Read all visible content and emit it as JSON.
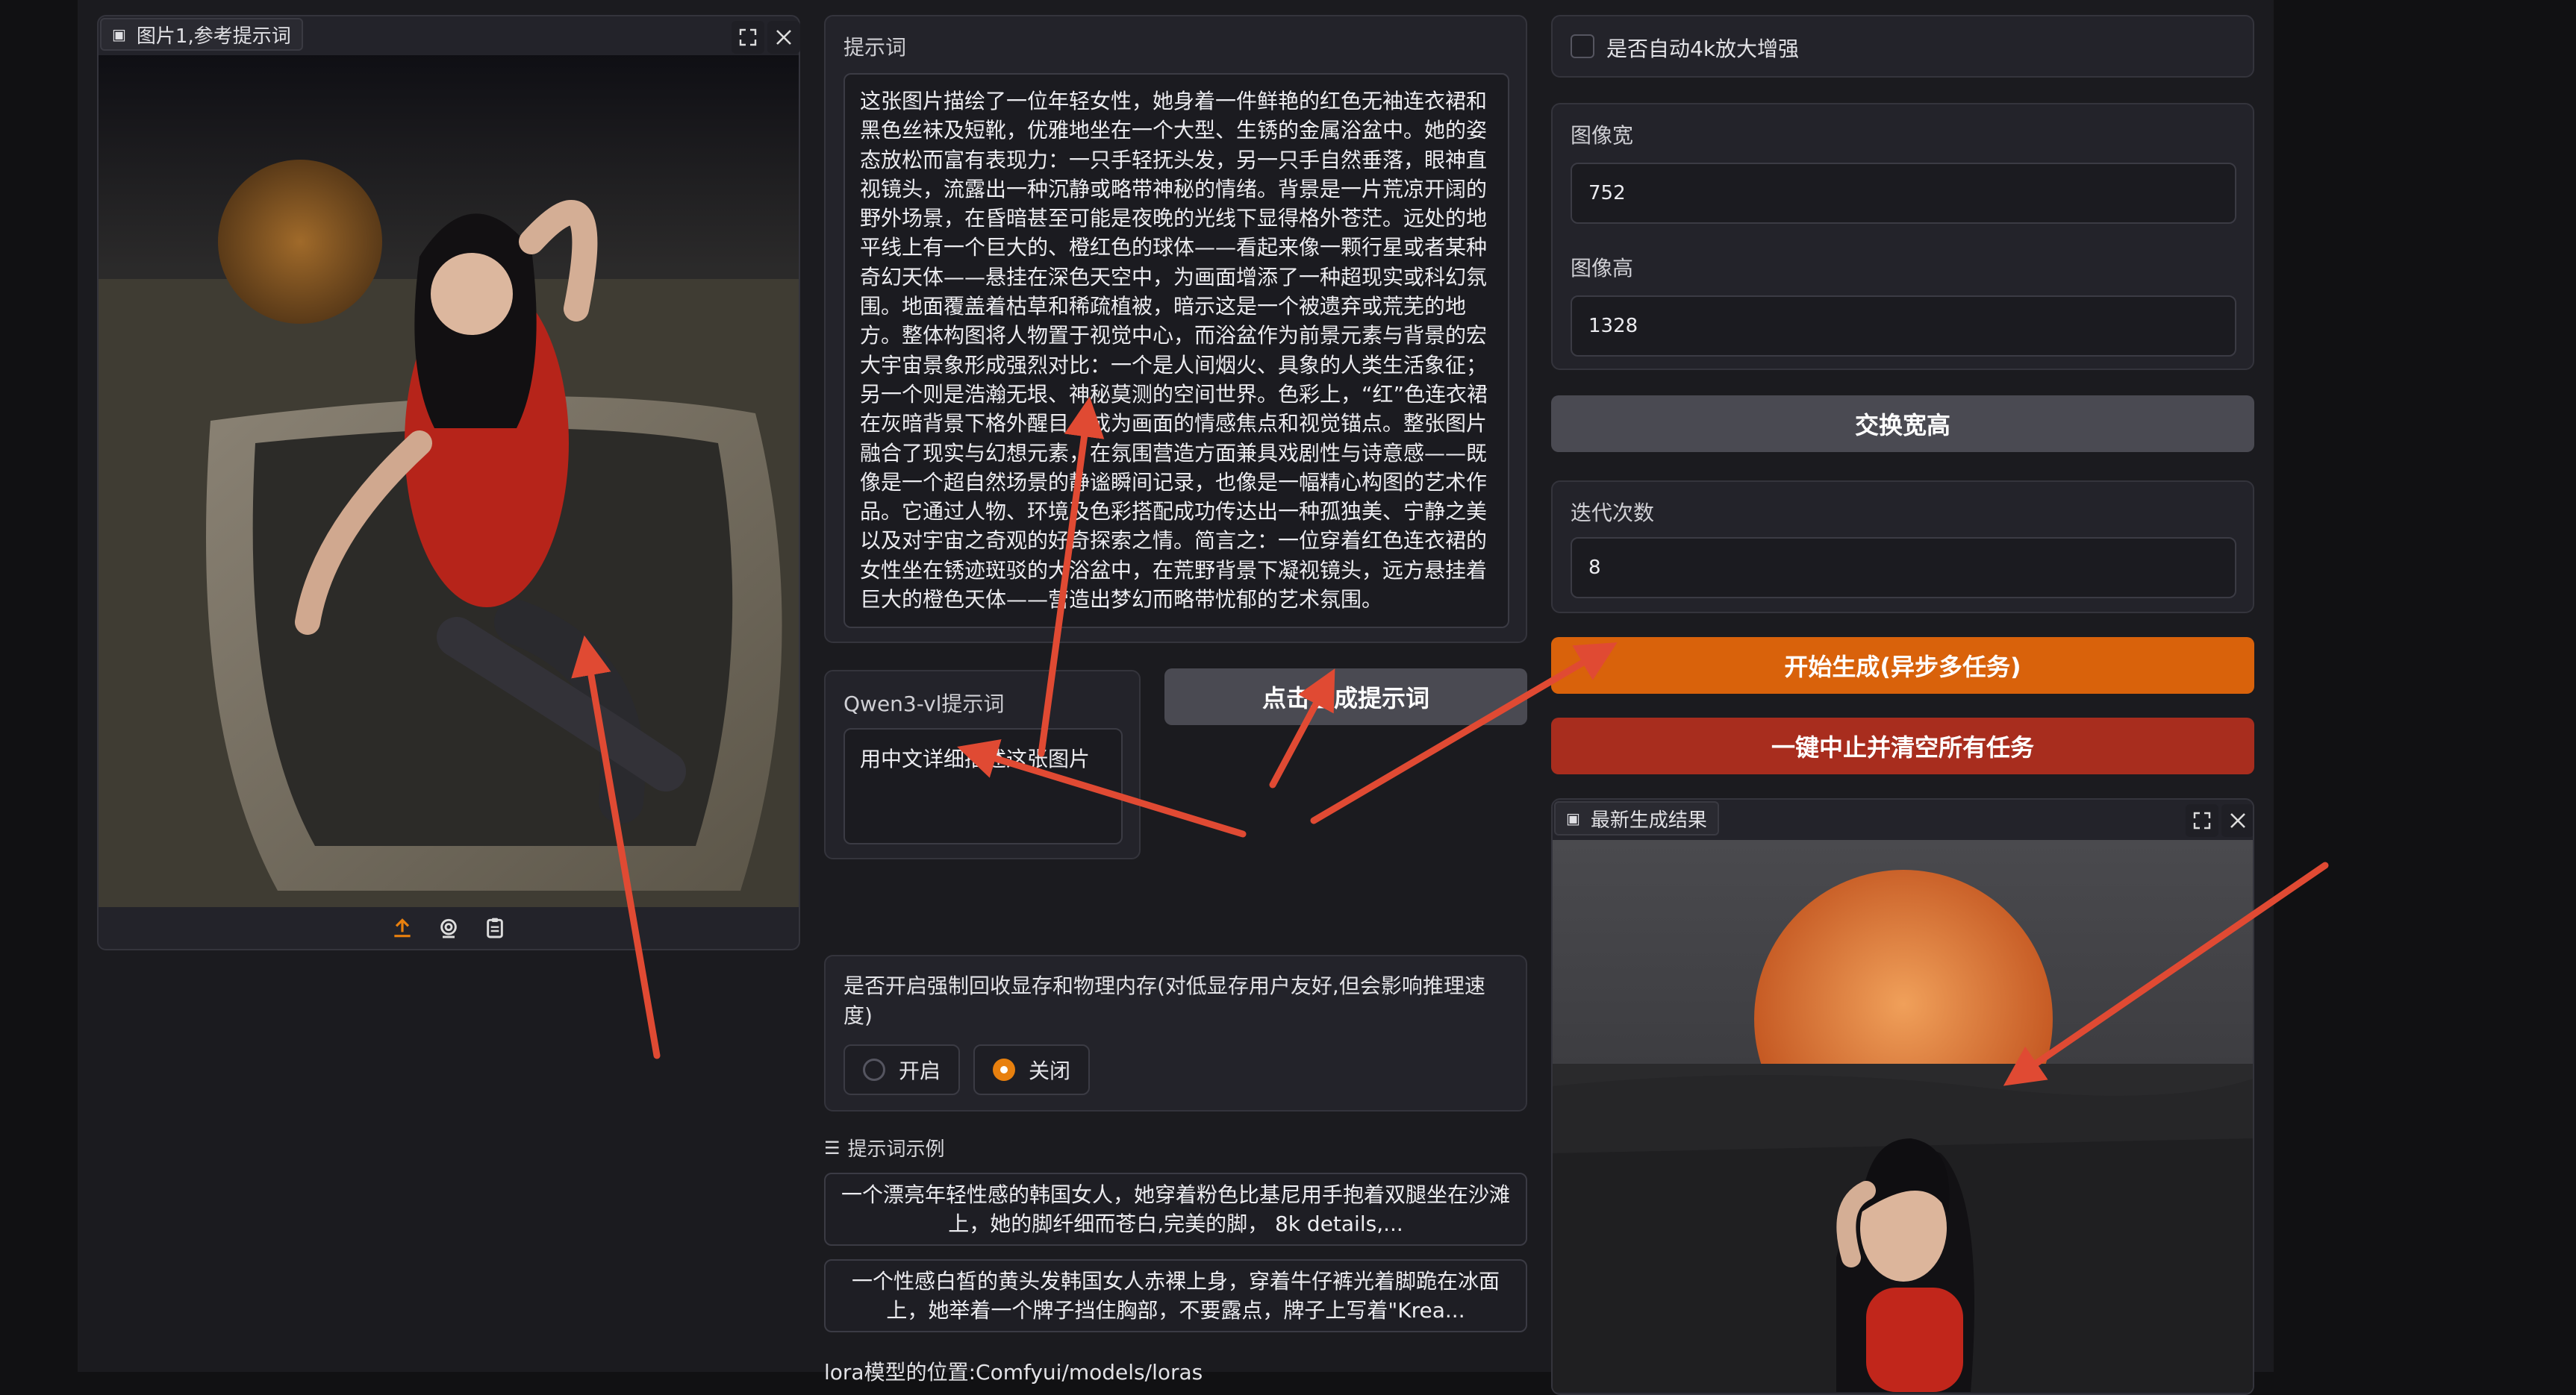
{
  "image_input": {
    "label": "图片1,参考提示词",
    "controls": [
      "upload-icon",
      "webcam-icon",
      "clipboard-icon"
    ]
  },
  "prompt": {
    "label": "提示词",
    "text": "这张图片描绘了一位年轻女性，她身着一件鲜艳的红色无袖连衣裙和黑色丝袜及短靴，优雅地坐在一个大型、生锈的金属浴盆中。她的姿态放松而富有表现力：一只手轻抚头发，另一只手自然垂落，眼神直视镜头，流露出一种沉静或略带神秘的情绪。背景是一片荒凉开阔的野外场景，在昏暗甚至可能是夜晚的光线下显得格外苍茫。远处的地平线上有一个巨大的、橙红色的球体——看起来像一颗行星或者某种奇幻天体——悬挂在深色天空中，为画面增添了一种超现实或科幻氛围。地面覆盖着枯草和稀疏植被，暗示这是一个被遗弃或荒芜的地方。整体构图将人物置于视觉中心，而浴盆作为前景元素与背景的宏大宇宙景象形成强烈对比：一个是人间烟火、具象的人类生活象征；另一个则是浩瀚无垠、神秘莫测的空间世界。色彩上，“红”色连衣裙在灰暗背景下格外醒目，成为画面的情感焦点和视觉锚点。整张图片融合了现实与幻想元素，在氛围营造方面兼具戏剧性与诗意感——既像是一个超自然场景的静谧瞬间记录，也像是一幅精心构图的艺术作品。它通过人物、环境及色彩搭配成功传达出一种孤独美、宁静之美以及对宇宙之奇观的好奇探索之情。简言之：一位穿着红色连衣裙的女性坐在锈迹斑驳的大浴盆中，在荒野背景下凝视镜头，远方悬挂着巨大的橙色天体——营造出梦幻而略带忧郁的艺术氛围。"
  },
  "qwen": {
    "label": "Qwen3-vl提示词",
    "value": "用中文详细描述这张图片"
  },
  "generate_prompt_button": "点击生成提示词",
  "memory": {
    "label": "是否开启强制回收显存和物理内存(对低显存用户友好,但会影响推理速度)",
    "options": [
      "开启",
      "关闭"
    ],
    "selected": "关闭"
  },
  "examples": {
    "header": "提示词示例",
    "items": [
      "一个漂亮年轻性感的韩国女人，她穿着粉色比基尼用手抱着双腿坐在沙滩上，她的脚纤细而苍白,完美的脚， 8k details,...",
      "一个性感白皙的黄头发韩国女人赤裸上身，穿着牛仔裤光着脚跪在冰面上，她举着一个牌子挡住胸部，不要露点，牌子上写着\"Krea..."
    ]
  },
  "lora_note": "lora模型的位置:Comfyui/models/loras",
  "upscale": {
    "label": "是否自动4k放大增强",
    "checked": false
  },
  "width": {
    "label": "图像宽",
    "value": "752"
  },
  "height": {
    "label": "图像高",
    "value": "1328"
  },
  "swap_button": "交换宽高",
  "iterations": {
    "label": "迭代次数",
    "value": "8"
  },
  "start_button": "开始生成(异步多任务)",
  "stop_button": "一键中止并清空所有任务",
  "output": {
    "label": "最新生成结果"
  },
  "colors": {
    "accent_orange": "#d9620b",
    "stop_red": "#a82d1e",
    "swap_gray": "#4a4a52",
    "arrow_red": "#e04a33"
  }
}
